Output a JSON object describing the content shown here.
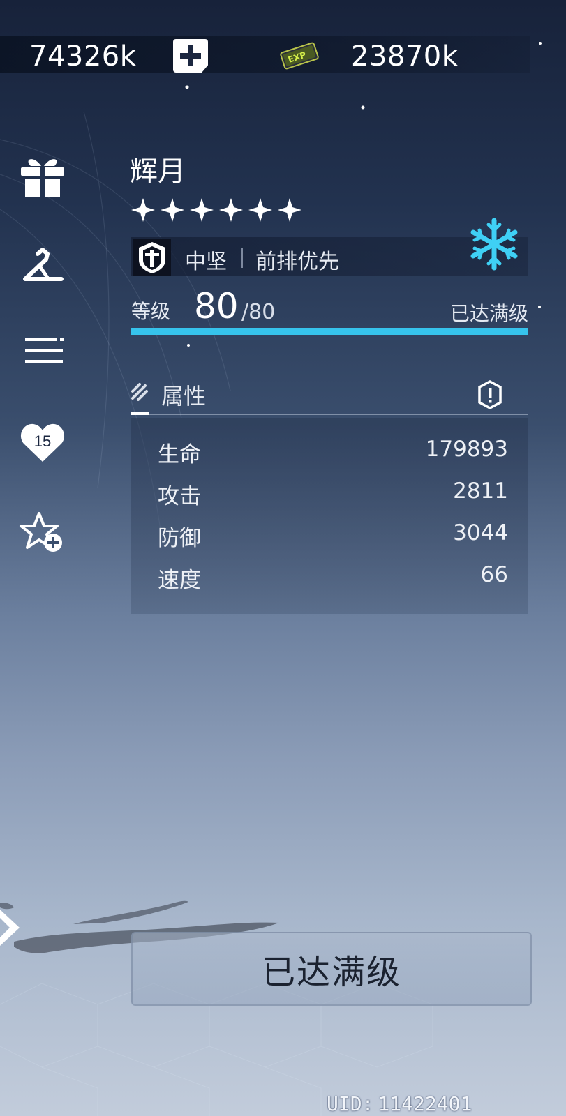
{
  "currencies": {
    "first_amount": "74326k",
    "second_amount": "23870k",
    "exp_icon_text": "EXP"
  },
  "rail": {
    "icons": [
      "gift-icon",
      "hanger-icon",
      "menu-lines-icon",
      "heart-level-icon",
      "star-plus-icon"
    ],
    "affection_level": "15"
  },
  "character": {
    "name": "辉月",
    "star_count": 6,
    "class_name": "中坚",
    "position_pref": "前排优先",
    "element_icon": "snowflake-icon",
    "element_color": "#3fd0f5"
  },
  "level": {
    "label": "等级",
    "current": "80",
    "max_display": "/80",
    "status": "已达满级",
    "progress_percent": 100,
    "bar_color": "#36c3ec"
  },
  "attributes": {
    "title": "属性",
    "rows": [
      {
        "label": "生命",
        "value": "179893"
      },
      {
        "label": "攻击",
        "value": "2811"
      },
      {
        "label": "防御",
        "value": "3044"
      },
      {
        "label": "速度",
        "value": "66"
      }
    ]
  },
  "footer": {
    "max_button_label": "已达满级",
    "uid_label": "UID:",
    "uid_value": "11422401"
  }
}
